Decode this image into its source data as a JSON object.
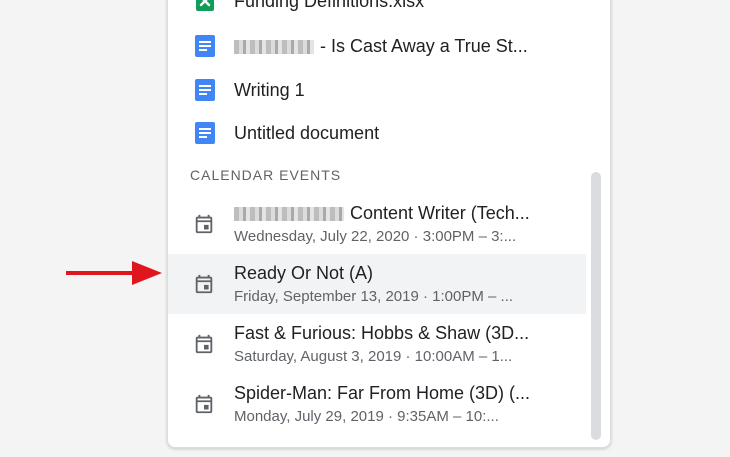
{
  "files": [
    {
      "name": "Funding Definitions.xlsx",
      "icon": "sheets-icon"
    },
    {
      "name": "- Is Cast Away a True St...",
      "icon": "docs-icon",
      "redacted": true
    },
    {
      "name": "Writing 1",
      "icon": "docs-icon"
    },
    {
      "name": "Untitled document",
      "icon": "docs-icon"
    }
  ],
  "calendar_section": {
    "header": "CALENDAR EVENTS"
  },
  "events": [
    {
      "title": "Content Writer (Tech...",
      "subtitle": "Wednesday, July 22, 2020 · 3:00PM – 3:...",
      "redacted": true
    },
    {
      "title": "Ready Or Not (A)",
      "subtitle": "Friday, September 13, 2019 · 1:00PM – ..."
    },
    {
      "title": "Fast & Furious: Hobbs & Shaw (3D...",
      "subtitle": "Saturday, August 3, 2019 · 10:00AM – 1..."
    },
    {
      "title": "Spider-Man: Far From Home (3D) (...",
      "subtitle": "Monday, July 29, 2019 · 9:35AM – 10:..."
    }
  ],
  "colors": {
    "sheets": "#0f9d58",
    "docs": "#4285f4",
    "arrow": "#e0161f",
    "selected_row": "#f1f3f4"
  }
}
